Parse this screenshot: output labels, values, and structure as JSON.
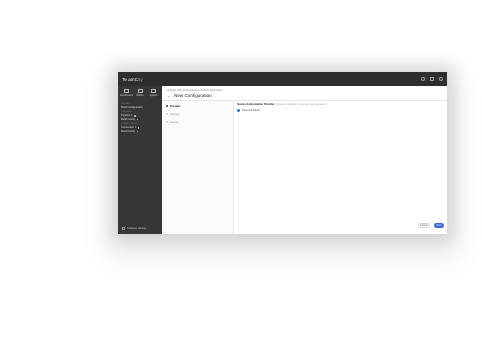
{
  "brand": {
    "name": "TeamCity",
    "name_a": "Te amC",
    "name_b": "ity"
  },
  "topbar": {
    "icons": [
      "help-icon",
      "notifications-icon",
      "profile-icon"
    ]
  },
  "sidebar": {
    "nav": [
      {
        "label": "Dashboard",
        "icon": "dashboard-icon"
      },
      {
        "label": "Builds",
        "icon": "builds-icon"
      },
      {
        "label": "Agents",
        "icon": "agents-icon"
      }
    ],
    "sections": [
      {
        "heading": "Project",
        "lines": [
          "Build Configuration"
        ]
      },
      {
        "heading": "Pipelines",
        "lines": [
          "Pipeline 1",
          "Build Config"
        ]
      },
      {
        "heading": "Connections",
        "lines": [
          "Connection 1",
          "Build Config"
        ]
      }
    ],
    "footer": "Collapse sidebar"
  },
  "breadcrumbs": "Settings  /  Build Management  /  Build Configuration",
  "page_title": "New Configuration",
  "steps": [
    {
      "label": "Provider",
      "active": true
    },
    {
      "label": "Settings",
      "active": false
    },
    {
      "label": "Review",
      "active": false
    }
  ],
  "question": {
    "title": "Source Authorization Provider",
    "subtitle": "Choose a provider to connect your repository",
    "option": "Personal Token"
  },
  "buttons": {
    "cancel": "Cancel",
    "next": "Next"
  },
  "colors": {
    "accent": "#3b66d6",
    "sidebar": "#363636",
    "topbar": "#2e2e2e"
  }
}
